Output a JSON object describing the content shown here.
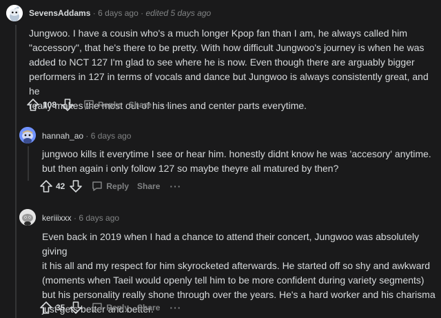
{
  "comments": [
    {
      "author": "SevensAddams",
      "sep": "·",
      "time": "6 days ago",
      "sep2": "·",
      "edited": "edited 5 days ago",
      "body": "Jungwoo. I have a cousin who's a much longer Kpop fan than I am, he always called him\n\"accessory\", that he's there to be pretty. With how difficult Jungwoo's journey is when he was\nadded to NCT 127 I'm glad to see where he is now. Even though there are arguably bigger\nperformers in 127 in terms of vocals and dance but Jungwoo is always consistently great, and he\nreally makes the most out of his lines and center parts everytime.",
      "score": "108",
      "reply_label": "Reply",
      "share_label": "Share",
      "more_label": "···"
    },
    {
      "author": "hannah_ao",
      "sep": "·",
      "time": "6 days ago",
      "body": "jungwoo kills it everytime I see or hear him. honestly didnt know he was 'accesory' anytime.\nbut then again i only follow 127 so maybe theyre all matured by then?",
      "score": "42",
      "reply_label": "Reply",
      "share_label": "Share",
      "more_label": "···"
    },
    {
      "author": "keriiixxx",
      "sep": "·",
      "time": "6 days ago",
      "body": "Even back in 2019 when I had a chance to attend their concert, Jungwoo was absolutely giving\nit his all and my respect for him skyrocketed afterwards. He started off so shy and awkward\n(moments when Taeil would openly tell him to be more confident during variety segments)\nbut his personality really shone through over the years. He's a hard worker and his charisma\njust gets better and better.",
      "score": "35",
      "reply_label": "Reply",
      "share_label": "Share",
      "more_label": "···"
    }
  ]
}
